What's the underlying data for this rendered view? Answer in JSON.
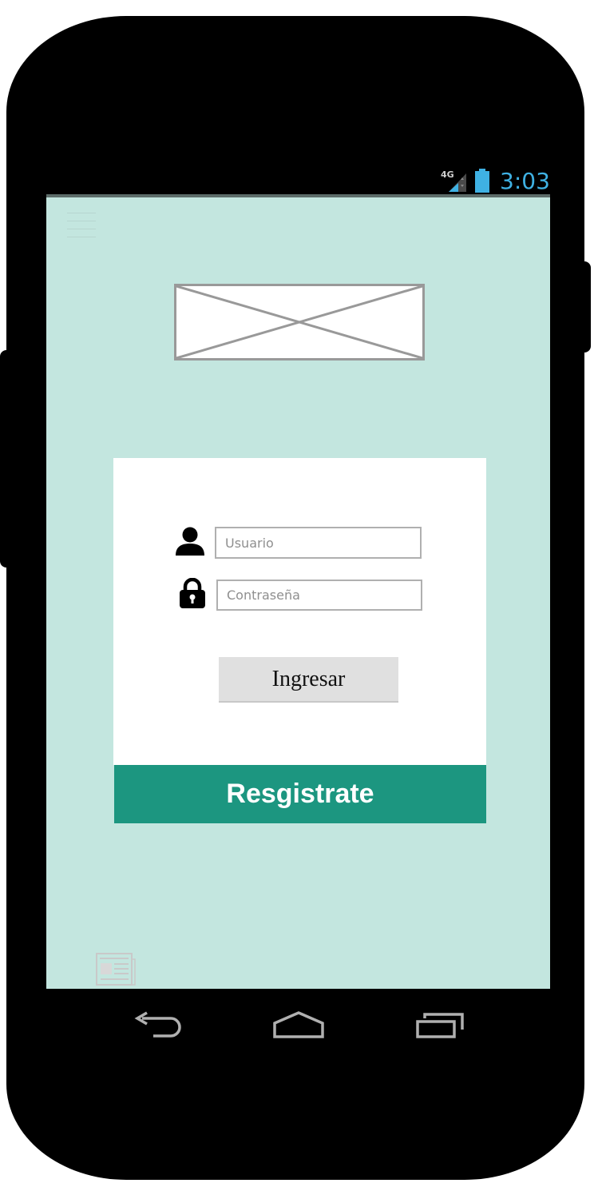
{
  "status_bar": {
    "network": "4G",
    "time": "3:03",
    "icons": [
      "signal-4g-icon",
      "battery-icon"
    ],
    "time_color": "#3fb1e3"
  },
  "screen": {
    "background": "#c3e6df",
    "menu_icon": "hamburger-menu-icon",
    "logo": "image-placeholder"
  },
  "login": {
    "username_placeholder": "Usuario",
    "password_placeholder": "Contraseña",
    "submit_label": "Ingresar",
    "register_label": "Resgistrate",
    "register_color": "#1c9680"
  },
  "navigation": {
    "buttons": [
      "back-icon",
      "home-icon",
      "recent-apps-icon"
    ]
  }
}
